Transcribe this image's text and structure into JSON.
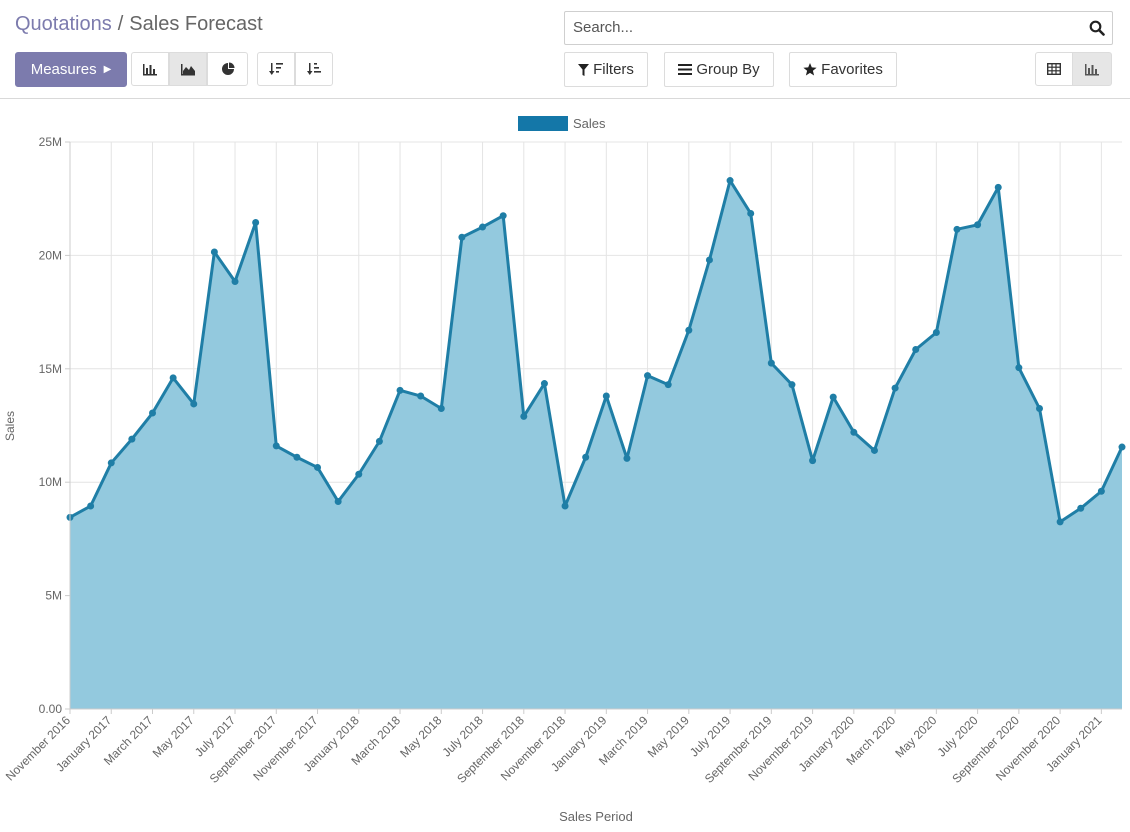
{
  "breadcrumb": {
    "parent": "Quotations",
    "separator": "/",
    "current": "Sales Forecast"
  },
  "toolbar": {
    "measures_label": "Measures",
    "filters_label": "Filters",
    "groupby_label": "Group By",
    "favorites_label": "Favorites"
  },
  "search": {
    "placeholder": "Search..."
  },
  "colors": {
    "accent": "#7c7bad",
    "series_line": "#1f7ea6",
    "series_fill": "#93c9de",
    "legend_swatch": "#1477a8"
  },
  "chart_data": {
    "type": "area",
    "title": "",
    "xlabel": "Sales Period",
    "ylabel": "Sales",
    "ylim": [
      0,
      25000000
    ],
    "y_ticks": [
      0,
      5000000,
      10000000,
      15000000,
      20000000,
      25000000
    ],
    "y_tick_labels": [
      "0.00",
      "5M",
      "10M",
      "15M",
      "20M",
      "25M"
    ],
    "grid": true,
    "legend_position": "top-center",
    "x": [
      "November 2016",
      "December 2016",
      "January 2017",
      "February 2017",
      "March 2017",
      "April 2017",
      "May 2017",
      "June 2017",
      "July 2017",
      "August 2017",
      "September 2017",
      "October 2017",
      "November 2017",
      "December 2017",
      "January 2018",
      "February 2018",
      "March 2018",
      "April 2018",
      "May 2018",
      "June 2018",
      "July 2018",
      "August 2018",
      "September 2018",
      "October 2018",
      "November 2018",
      "December 2018",
      "January 2019",
      "February 2019",
      "March 2019",
      "April 2019",
      "May 2019",
      "June 2019",
      "July 2019",
      "August 2019",
      "September 2019",
      "October 2019",
      "November 2019",
      "December 2019",
      "January 2020",
      "February 2020",
      "March 2020",
      "April 2020",
      "May 2020",
      "June 2020",
      "July 2020",
      "August 2020",
      "September 2020",
      "October 2020",
      "November 2020",
      "December 2020",
      "January 2021",
      "February 2021"
    ],
    "x_tick_labels": [
      "November 2016",
      "January 2017",
      "March 2017",
      "May 2017",
      "July 2017",
      "September 2017",
      "November 2017",
      "January 2018",
      "March 2018",
      "May 2018",
      "July 2018",
      "September 2018",
      "November 2018",
      "January 2019",
      "March 2019",
      "May 2019",
      "July 2019",
      "September 2019",
      "November 2019",
      "January 2020",
      "March 2020",
      "May 2020",
      "July 2020",
      "September 2020",
      "November 2020",
      "January 2021"
    ],
    "series": [
      {
        "name": "Sales",
        "values": [
          8450000,
          8950000,
          10850000,
          11900000,
          13050000,
          14600000,
          13450000,
          20150000,
          18850000,
          21450000,
          11600000,
          11100000,
          10650000,
          9150000,
          10350000,
          11800000,
          14050000,
          13800000,
          13250000,
          20800000,
          21250000,
          21750000,
          12900000,
          14350000,
          8950000,
          11100000,
          13800000,
          11050000,
          14700000,
          14300000,
          16700000,
          19800000,
          23300000,
          21850000,
          15250000,
          14300000,
          10950000,
          13750000,
          12200000,
          11400000,
          14150000,
          15850000,
          16600000,
          21150000,
          21350000,
          23000000,
          15050000,
          13250000,
          8250000,
          8850000,
          9600000,
          11550000
        ]
      }
    ]
  }
}
